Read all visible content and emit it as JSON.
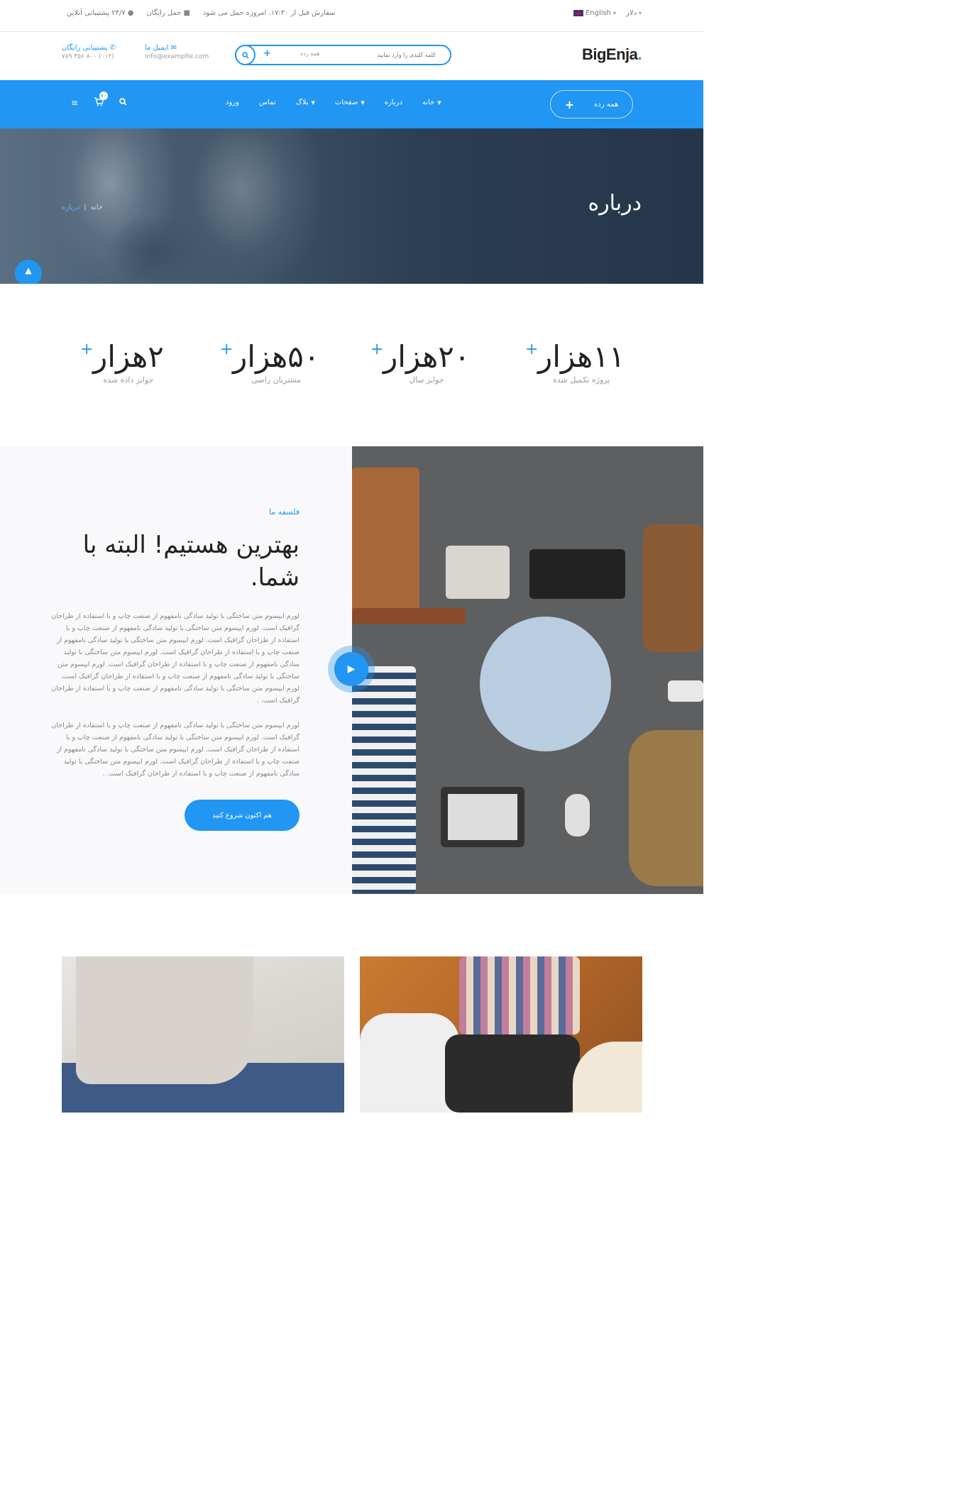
{
  "topbar": {
    "language": "English",
    "currency": "دلار",
    "order_note": "سفارش قبل از ۱۷:۳۰، امروزه حمل می شود",
    "free_shipping": "حمل رایگان",
    "support": "۲۴/۷ پشتیبانی آنلاین"
  },
  "header": {
    "logo_text": "BigEnja",
    "logo_dot": ".",
    "search_placeholder": "کلمه کلیدی را وارد نمایید",
    "search_category": "همه رده",
    "search_plus": "+",
    "email_title": "ایمیل ما",
    "email_value": "info@examplte.com",
    "phone_title": "پشتیبانی رایگان",
    "phone_value": "(۰۱۲) ۸۰۰ ۴۵۶ ۷۸۹"
  },
  "nav": {
    "all_categories": "همه رده",
    "items": [
      {
        "label": "خانه",
        "has_dropdown": true
      },
      {
        "label": "درباره",
        "has_dropdown": false
      },
      {
        "label": "صفحات",
        "has_dropdown": true
      },
      {
        "label": "بلاگ",
        "has_dropdown": true
      },
      {
        "label": "تماس",
        "has_dropdown": false
      },
      {
        "label": "ورود",
        "has_dropdown": false
      }
    ],
    "cart_count": "۱۰"
  },
  "hero": {
    "title": "درباره",
    "breadcrumb_home": "خانه",
    "breadcrumb_sep": "|",
    "breadcrumb_current": "درباره"
  },
  "stats": [
    {
      "value": "۱۱هزار",
      "label": "پروژه تکمیل شده"
    },
    {
      "value": "۲۰هزار",
      "label": "جوایز سال"
    },
    {
      "value": "۵۰هزار",
      "label": "مشتریان راضی"
    },
    {
      "value": "۲هزار",
      "label": "جوایز داده شده"
    }
  ],
  "philosophy": {
    "tag": "فلسفه ما",
    "title": "بهترین هستیم! البته با شما.",
    "paragraph1": "لورم ایپسوم متن ساختگی با تولید سادگی نامفهوم از صنعت چاپ و با استفاده از طراحان گرافیک است. لورم ایپسوم متن ساختگی با تولید سادگی نامفهوم از صنعت چاپ و با استفاده از طراحان گرافیک است. لورم ایپسوم متن ساختگی با تولید سادگی نامفهوم از صنعت چاپ و با استفاده از طراحان گرافیک است. لورم ایپسوم متن ساختگی با تولید سادگی نامفهوم از صنعت چاپ و با استفاده از طراحان گرافیک است. لورم ایپسوم متن ساختگی با تولید سادگی نامفهوم از صنعت چاپ و با استفاده از طراحان گرافیک است. لورم ایپسوم متن ساختگی با تولید سادگی نامفهوم از صنعت چاپ و با استفاده از طراحان گرافیک است. .",
    "paragraph2": "لورم ایپسوم متن ساختگی با تولید سادگی نامفهوم از صنعت چاپ و با استفاده از طراحان گرافیک است. لورم ایپسوم متن ساختگی با تولید سادگی نامفهوم از صنعت چاپ و با استفاده از طراحان گرافیک است. لورم ایپسوم متن ساختگی با تولید سادگی نامفهوم از صنعت چاپ و با استفاده از طراحان گرافیک است. لورم ایپسوم متن ساختگی با تولید سادگی نامفهوم از صنعت چاپ و با استفاده از طراحان گرافیک است. .",
    "cta": "هم اکنون شروع کنید"
  },
  "colors": {
    "accent": "#2196f3",
    "hero_dark": "#2c3e52"
  }
}
